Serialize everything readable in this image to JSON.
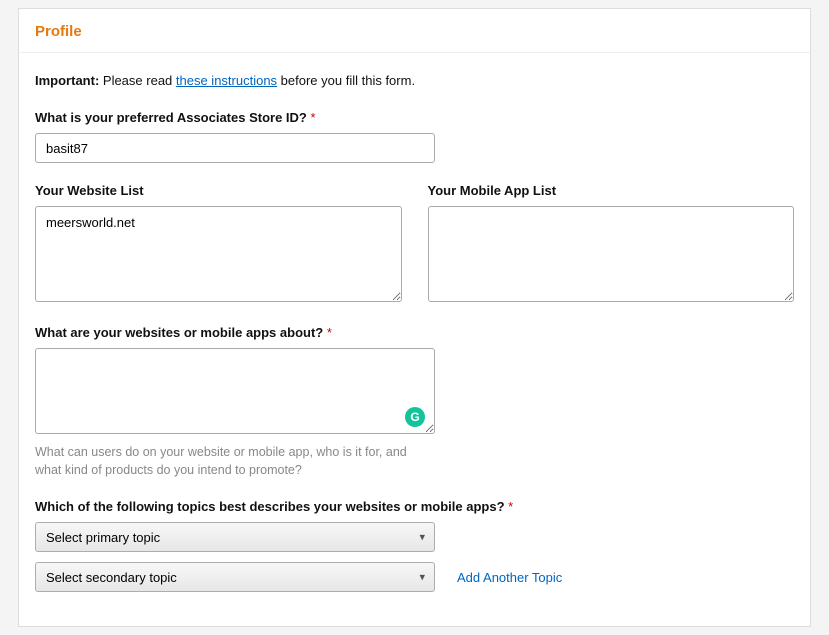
{
  "panel": {
    "title": "Profile"
  },
  "important": {
    "bold": "Important:",
    "before": " Please read ",
    "link": "these instructions",
    "after": " before you fill this form."
  },
  "storeId": {
    "label": "What is your preferred Associates Store ID? ",
    "req": "*",
    "value": "basit87"
  },
  "websiteList": {
    "label": "Your Website List",
    "value": "meersworld.net"
  },
  "mobileList": {
    "label": "Your Mobile App List",
    "value": ""
  },
  "about": {
    "label": "What are your websites or mobile apps about? ",
    "req": "*",
    "value": "",
    "hint1": "What can users do on your website or mobile app, who is it for, and",
    "hint2": "what kind of products do you intend to promote?"
  },
  "topics": {
    "label": "Which of the following topics best describes your websites or mobile apps? ",
    "req": "*",
    "primary": "Select primary topic",
    "secondary": "Select secondary topic",
    "addAnother": "Add Another Topic"
  }
}
